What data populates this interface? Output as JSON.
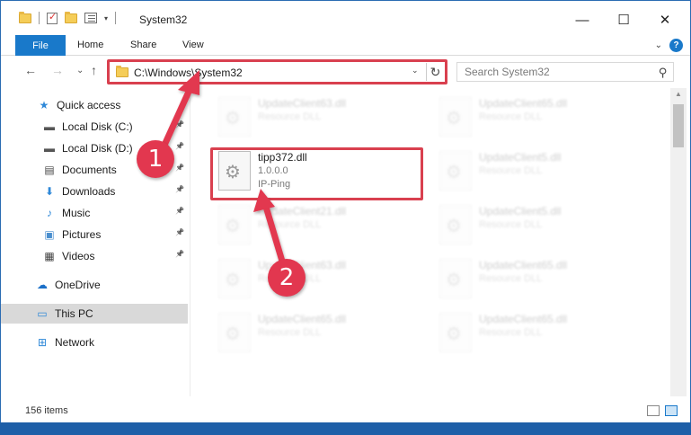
{
  "window": {
    "title": "System32",
    "controls": {
      "minimize": "—",
      "maximize": "☐",
      "close": "✕"
    }
  },
  "ribbon": {
    "tabs": [
      "File",
      "Home",
      "Share",
      "View"
    ],
    "help": "?"
  },
  "navbar": {
    "back": "←",
    "forward": "→",
    "recent": "⌄",
    "up": "↑",
    "address": "C:\\Windows\\System32",
    "refresh": "↻",
    "search_placeholder": "Search System32",
    "search_icon": "⚲"
  },
  "sidebar": {
    "items": [
      {
        "label": "Quick access",
        "icon": "star-icon",
        "glyph": "★",
        "color": "#2e88d8",
        "pinned": false
      },
      {
        "label": "Local Disk (C:)",
        "icon": "drive-icon",
        "glyph": "▬",
        "color": "#555555",
        "pinned": true
      },
      {
        "label": "Local Disk (D:)",
        "icon": "drive-icon",
        "glyph": "▬",
        "color": "#555555",
        "pinned": true
      },
      {
        "label": "Documents",
        "icon": "documents-icon",
        "glyph": "▤",
        "color": "#4a4a4a",
        "pinned": true
      },
      {
        "label": "Downloads",
        "icon": "downloads-icon",
        "glyph": "⬇",
        "color": "#2e88d8",
        "pinned": true
      },
      {
        "label": "Music",
        "icon": "music-icon",
        "glyph": "♪",
        "color": "#2e88d8",
        "pinned": true
      },
      {
        "label": "Pictures",
        "icon": "pictures-icon",
        "glyph": "▣",
        "color": "#4a8fcf",
        "pinned": true
      },
      {
        "label": "Videos",
        "icon": "videos-icon",
        "glyph": "▦",
        "color": "#444444",
        "pinned": true
      },
      {
        "label": "OneDrive",
        "icon": "onedrive-icon",
        "glyph": "☁",
        "color": "#1a6fc8",
        "pinned": false
      },
      {
        "label": "This PC",
        "icon": "this-pc-icon",
        "glyph": "▭",
        "color": "#2e88d8",
        "pinned": false,
        "selected": true
      },
      {
        "label": "Network",
        "icon": "network-icon",
        "glyph": "⊞",
        "color": "#2e88d8",
        "pinned": false
      }
    ],
    "pin_glyph": "📌"
  },
  "files": [
    {
      "name": "UpdateClient63.dll",
      "l2": "Resource DLL",
      "l3": "",
      "faded": true
    },
    {
      "name": "UpdateClient65.dll",
      "l2": "Resource DLL",
      "l3": "",
      "faded": true
    },
    {
      "name": "tipp372.dll",
      "l2": "1.0.0.0",
      "l3": "IP-Ping",
      "faded": false
    },
    {
      "name": "UpdateClient5.dll",
      "l2": "Resource DLL",
      "l3": "",
      "faded": true
    },
    {
      "name": "UpdateClient21.dll",
      "l2": "Resource DLL",
      "l3": "",
      "faded": true
    },
    {
      "name": "UpdateClient5.dll",
      "l2": "Resource DLL",
      "l3": "",
      "faded": true
    },
    {
      "name": "UpdateClient63.dll",
      "l2": "Resource DLL",
      "l3": "",
      "faded": true
    },
    {
      "name": "UpdateClient65.dll",
      "l2": "Resource DLL",
      "l3": "",
      "faded": true
    },
    {
      "name": "UpdateClient65.dll",
      "l2": "Resource DLL",
      "l3": "",
      "faded": true
    },
    {
      "name": "UpdateClient65.dll",
      "l2": "Resource DLL",
      "l3": "",
      "faded": true
    }
  ],
  "status": {
    "count": "156 items"
  },
  "annotations": {
    "badge1": "1",
    "badge2": "2",
    "color": "#e2374f"
  }
}
